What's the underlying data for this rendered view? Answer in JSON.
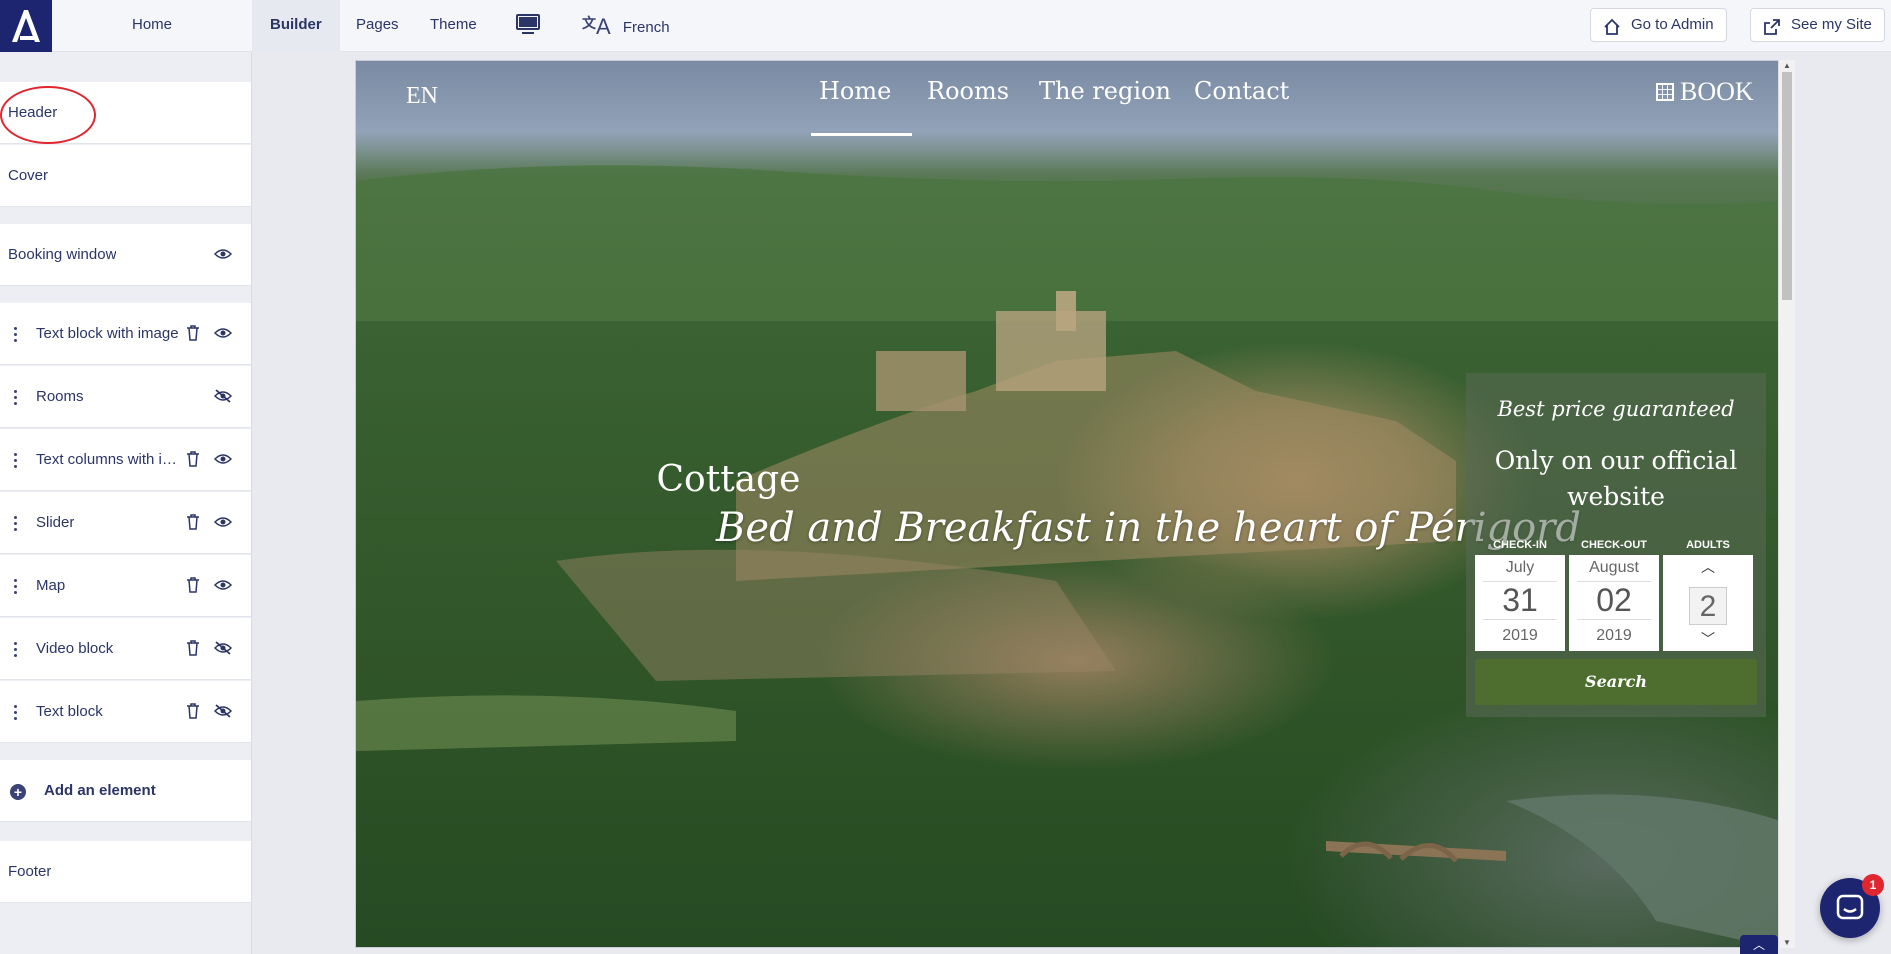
{
  "topbar": {
    "home_label": "Home",
    "tabs": [
      {
        "label": "Builder",
        "active": true
      },
      {
        "label": "Pages",
        "active": false
      },
      {
        "label": "Theme",
        "active": false
      }
    ],
    "language_label": "French",
    "go_admin_label": "Go to Admin",
    "see_site_label": "See my Site"
  },
  "sidebar": {
    "header": "Header",
    "cover": "Cover",
    "booking": "Booking window",
    "items": [
      {
        "label": "Text block with image",
        "visible": true
      },
      {
        "label": "Rooms",
        "visible": false
      },
      {
        "label": "Text columns with images",
        "visible": true
      },
      {
        "label": "Slider",
        "visible": true
      },
      {
        "label": "Map",
        "visible": true
      },
      {
        "label": "Video block",
        "visible": false
      },
      {
        "label": "Text block",
        "visible": false
      }
    ],
    "add_element": "Add an element",
    "footer": "Footer"
  },
  "preview": {
    "lang": "EN",
    "menu": [
      "Home",
      "Rooms",
      "The region",
      "Contact"
    ],
    "book": "BOOK",
    "title": "Cottage",
    "subtitle": "Bed and Breakfast in the heart of Périgord",
    "widget": {
      "best_price": "Best price guaranteed",
      "only_official": "Only on our official website",
      "checkin_label": "CHECK-IN",
      "checkout_label": "CHECK-OUT",
      "adults_label": "ADULTS",
      "checkin": {
        "month": "July",
        "day": "31",
        "year": "2019"
      },
      "checkout": {
        "month": "August",
        "day": "02",
        "year": "2019"
      },
      "adults": "2",
      "search_label": "Search"
    }
  },
  "chat": {
    "badge": "1"
  },
  "colors": {
    "brand": "#1d2570",
    "highlight_circle": "#e0262e",
    "search_button": "#4e6e30"
  }
}
